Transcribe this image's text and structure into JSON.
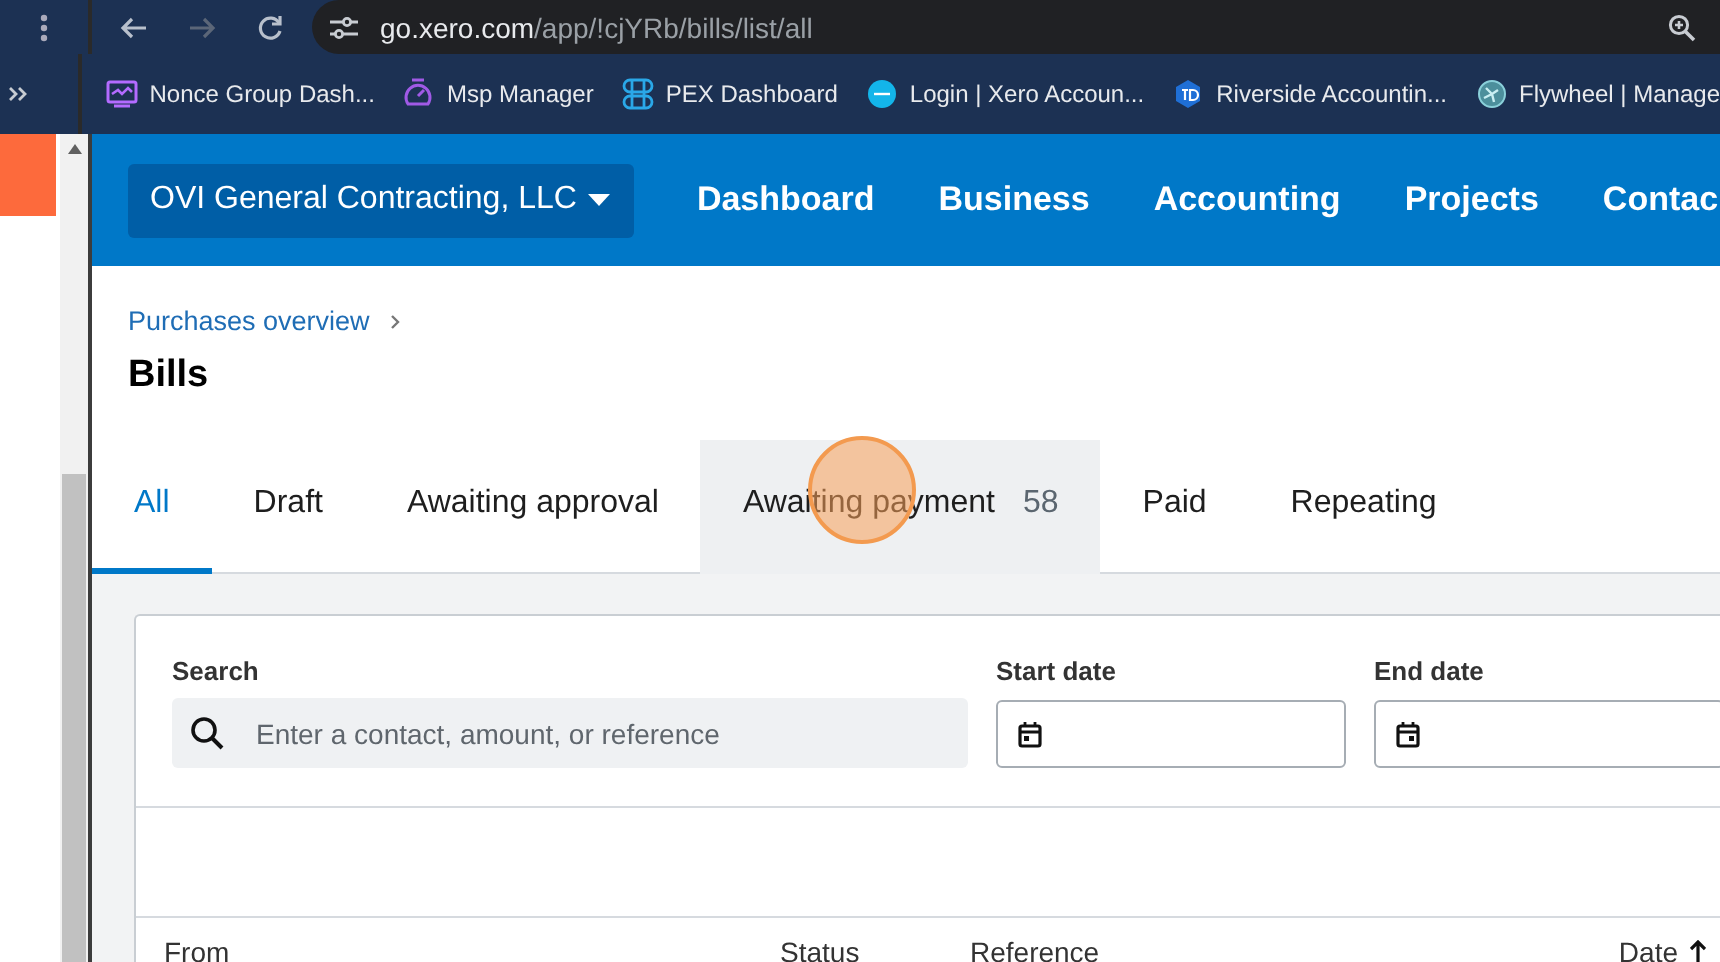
{
  "browser": {
    "url_host": "go.xero.com",
    "url_path": "/app/!cjYRb/bills/list/all",
    "bookmarks": [
      {
        "label": "Nonce Group Dash...",
        "kind": "chart"
      },
      {
        "label": "Msp Manager",
        "kind": "gauge"
      },
      {
        "label": "PEX Dashboard",
        "kind": "grid"
      },
      {
        "label": "Login | Xero Accoun...",
        "kind": "xero"
      },
      {
        "label": "Riverside Accountin...",
        "kind": "td"
      },
      {
        "label": "Flywheel | Manage",
        "kind": "fan"
      }
    ]
  },
  "nav": {
    "organisation": "OVI General Contracting, LLC",
    "items": [
      "Dashboard",
      "Business",
      "Accounting",
      "Projects",
      "Contac"
    ]
  },
  "breadcrumb": "Purchases overview",
  "title": "Bills",
  "tabs": [
    {
      "label": "All",
      "selected": true,
      "hovered": false
    },
    {
      "label": "Draft",
      "selected": false,
      "hovered": false
    },
    {
      "label": "Awaiting approval",
      "selected": false,
      "hovered": false
    },
    {
      "label": "Awaiting payment",
      "count": "58",
      "selected": false,
      "hovered": true
    },
    {
      "label": "Paid",
      "selected": false,
      "hovered": false
    },
    {
      "label": "Repeating",
      "selected": false,
      "hovered": false
    }
  ],
  "filters": {
    "search": {
      "label": "Search",
      "placeholder": "Enter a contact, amount, or reference"
    },
    "start_date": {
      "label": "Start date"
    },
    "end_date": {
      "label": "End date"
    }
  },
  "table": {
    "columns": [
      {
        "label": "From",
        "sorted": false
      },
      {
        "label": "Status",
        "sorted": false
      },
      {
        "label": "Reference",
        "sorted": false
      },
      {
        "label": "Date",
        "sorted": true
      }
    ]
  }
}
